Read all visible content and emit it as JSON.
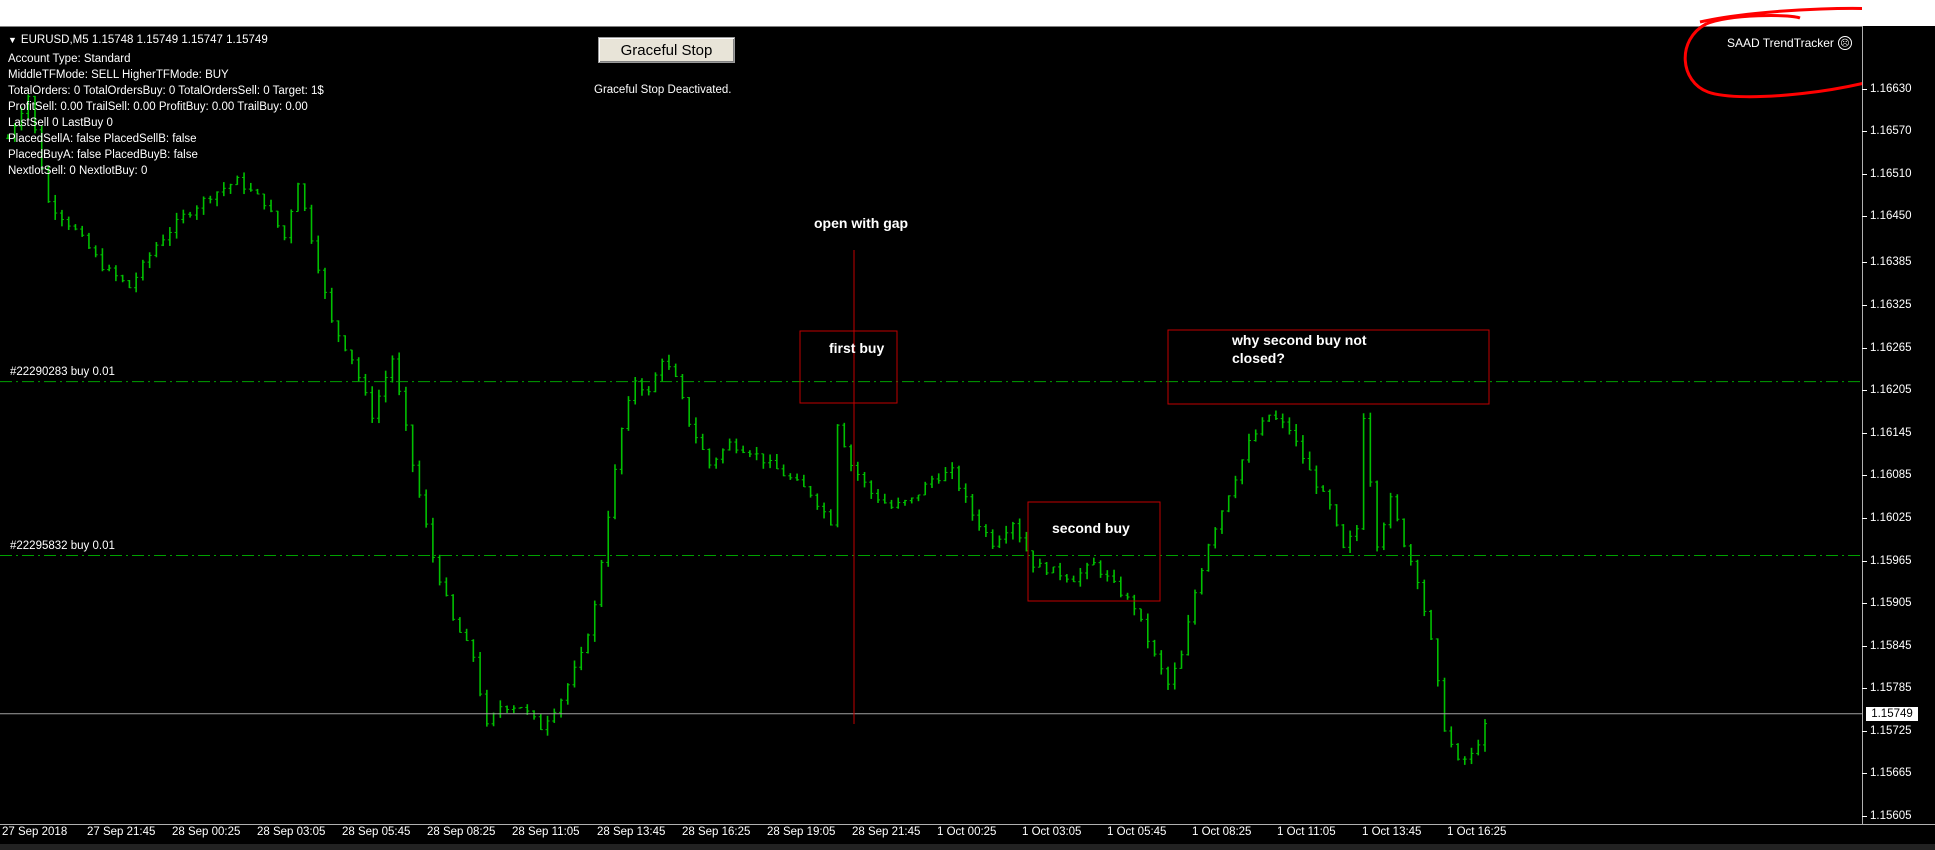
{
  "header": {
    "symbol_line": "EURUSD,M5  1.15748 1.15749 1.15747 1.15749",
    "info_lines": [
      "Account Type:  Standard",
      "MiddleTFMode:  SELL  HigherTFMode:  BUY",
      "TotalOrders: 0    TotalOrdersBuy: 0    TotalOrdersSell: 0   Target: 1$",
      "ProfitSell: 0.00  TrailSell: 0.00   ProfitBuy: 0.00   TrailBuy: 0.00",
      "LastSell 0  LastBuy 0",
      "PlacedSellA: false  PlacedSellB: false",
      "PlacedBuyA: false  PlacedBuyB: false",
      "NextlotSell:  0   NextlotBuy:  0"
    ]
  },
  "controls": {
    "graceful_stop_label": "Graceful Stop",
    "graceful_stop_status": "Graceful Stop Deactivated."
  },
  "ea": {
    "name": "SAAD TrendTracker",
    "status_icon": "smiley-icon"
  },
  "orders": [
    {
      "label": "#22290283 buy 0.01",
      "price": 1.16217
    },
    {
      "label": "#22295832 buy 0.01",
      "price": 1.15972
    }
  ],
  "annotations": {
    "open_gap": "open with gap",
    "first_buy": "first buy",
    "second_buy": "second buy",
    "why_not_closed_line1": "why second buy not",
    "why_not_closed_line2": "closed?"
  },
  "current_price": "1.15749",
  "price_axis": [
    "1.16630",
    "1.16570",
    "1.16510",
    "1.16450",
    "1.16385",
    "1.16325",
    "1.16265",
    "1.16205",
    "1.16145",
    "1.16085",
    "1.16025",
    "1.15965",
    "1.15905",
    "1.15845",
    "1.15785",
    "1.15725",
    "1.15665",
    "1.15605"
  ],
  "time_axis": [
    "27 Sep 2018",
    "27 Sep 21:45",
    "28 Sep 00:25",
    "28 Sep 03:05",
    "28 Sep 05:45",
    "28 Sep 08:25",
    "28 Sep 11:05",
    "28 Sep 13:45",
    "28 Sep 16:25",
    "28 Sep 19:05",
    "28 Sep 21:45",
    "1 Oct 00:25",
    "1 Oct 03:05",
    "1 Oct 05:45",
    "1 Oct 08:25",
    "1 Oct 11:05",
    "1 Oct 13:45",
    "1 Oct 16:25"
  ],
  "colors": {
    "background": "#000000",
    "bars": "#00c000",
    "order_line": "#00a000",
    "annotation_box": "#c00000",
    "highlight_circle": "#ff0000",
    "gap_line": "#c00000"
  },
  "chart_data": {
    "type": "ohlc",
    "symbol": "EURUSD",
    "timeframe": "M5",
    "ylim": [
      1.15605,
      1.1669
    ],
    "close_path": [
      [
        0,
        1.1656
      ],
      [
        3,
        1.1662
      ],
      [
        6,
        1.1647
      ],
      [
        10,
        1.1643
      ],
      [
        14,
        1.1638
      ],
      [
        18,
        1.1635
      ],
      [
        22,
        1.1641
      ],
      [
        26,
        1.1645
      ],
      [
        30,
        1.1648
      ],
      [
        34,
        1.165
      ],
      [
        38,
        1.1647
      ],
      [
        41,
        1.1642
      ],
      [
        43,
        1.165
      ],
      [
        45,
        1.1642
      ],
      [
        48,
        1.163
      ],
      [
        51,
        1.1625
      ],
      [
        54,
        1.1617
      ],
      [
        57,
        1.1625
      ],
      [
        60,
        1.161
      ],
      [
        63,
        1.1597
      ],
      [
        66,
        1.1588
      ],
      [
        69,
        1.1583
      ],
      [
        71,
        1.1573
      ],
      [
        73,
        1.1576
      ],
      [
        76,
        1.1576
      ],
      [
        79,
        1.1573
      ],
      [
        82,
        1.1577
      ],
      [
        85,
        1.1583
      ],
      [
        87,
        1.159
      ],
      [
        89,
        1.1603
      ],
      [
        91,
        1.1615
      ],
      [
        93,
        1.1622
      ],
      [
        95,
        1.162
      ],
      [
        97,
        1.1625
      ],
      [
        99,
        1.1622
      ],
      [
        101,
        1.1616
      ],
      [
        104,
        1.161
      ],
      [
        107,
        1.1613
      ],
      [
        110,
        1.1612
      ],
      [
        113,
        1.161
      ],
      [
        116,
        1.1608
      ],
      [
        119,
        1.1606
      ],
      [
        122,
        1.1602
      ],
      [
        123,
        1.1616
      ],
      [
        125,
        1.161
      ],
      [
        128,
        1.1606
      ],
      [
        131,
        1.1604
      ],
      [
        134,
        1.1605
      ],
      [
        137,
        1.1608
      ],
      [
        140,
        1.1609
      ],
      [
        143,
        1.1603
      ],
      [
        146,
        1.1599
      ],
      [
        149,
        1.1602
      ],
      [
        152,
        1.1596
      ],
      [
        155,
        1.1595
      ],
      [
        158,
        1.1594
      ],
      [
        161,
        1.1596
      ],
      [
        164,
        1.1593
      ],
      [
        167,
        1.159
      ],
      [
        170,
        1.1583
      ],
      [
        172,
        1.1579
      ],
      [
        174,
        1.1583
      ],
      [
        176,
        1.1592
      ],
      [
        178,
        1.1599
      ],
      [
        181,
        1.1606
      ],
      [
        184,
        1.1613
      ],
      [
        187,
        1.1617
      ],
      [
        190,
        1.1615
      ],
      [
        193,
        1.1609
      ],
      [
        196,
        1.1604
      ],
      [
        198,
        1.1598
      ],
      [
        200,
        1.1601
      ],
      [
        201,
        1.1617
      ],
      [
        203,
        1.1599
      ],
      [
        205,
        1.1605
      ],
      [
        207,
        1.1599
      ],
      [
        209,
        1.1594
      ],
      [
        211,
        1.1585
      ],
      [
        213,
        1.1573
      ],
      [
        215,
        1.1568
      ],
      [
        217,
        1.1569
      ],
      [
        219,
        1.1573
      ]
    ],
    "bar_count": 220,
    "note_markers": {
      "first_buy_box": [
        1.16265,
        1.16175
      ],
      "second_buy_box": [
        1.1604,
        1.159
      ],
      "why_box": [
        1.16265,
        1.16165
      ],
      "current": 1.15749
    }
  }
}
